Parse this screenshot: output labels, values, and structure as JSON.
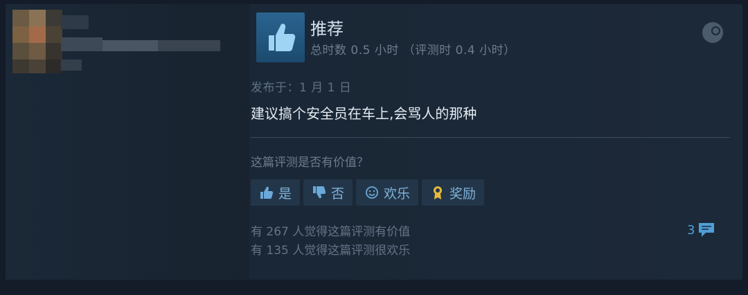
{
  "review": {
    "verdict": "推荐",
    "hours": "总时数 0.5 小时 （评测时 0.4 小时）",
    "posted": "发布于：1 月 1 日",
    "content": "建议搞个安全员在车上,会骂人的那种"
  },
  "feedback": {
    "question": "这篇评测是否有价值？",
    "buttons": {
      "yes": "是",
      "no": "否",
      "funny": "欢乐",
      "award": "奖励"
    }
  },
  "stats": {
    "helpful": "有 267 人觉得这篇评测有价值",
    "funny": "有 135 人觉得这篇评测很欢乐",
    "comment_count": "3"
  },
  "colors": {
    "accent": "#4f9fd6",
    "button_bg": "#233649",
    "thumb_bg": "#2a6490"
  },
  "icons": {
    "thumb": "thumbs-up-icon",
    "steam": "steam-icon",
    "comment": "comment-bubble-icon"
  }
}
